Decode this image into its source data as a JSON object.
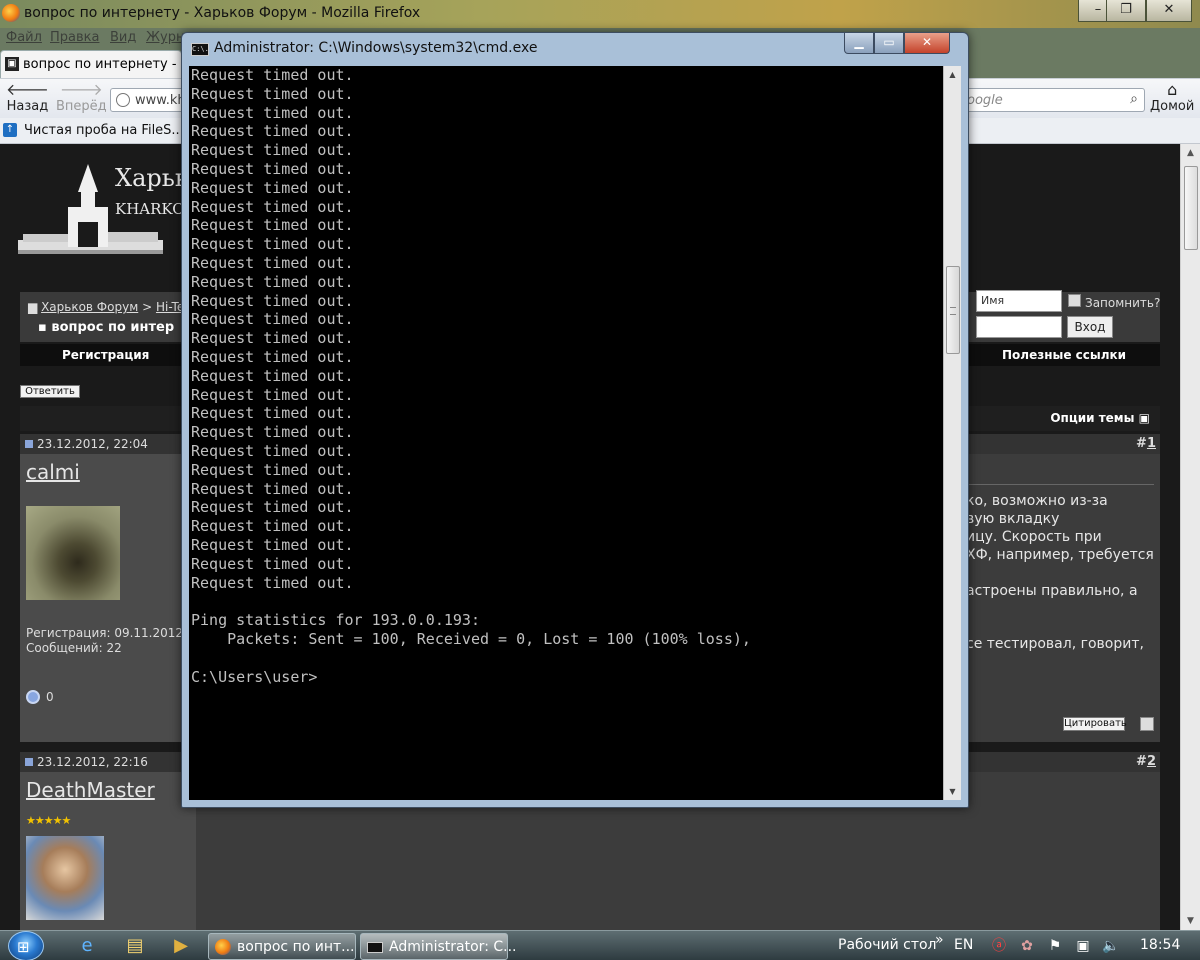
{
  "firefox": {
    "window_title": "вопрос по интернету - Харьков Форум - Mozilla Firefox",
    "menu": [
      "Файл",
      "Правка",
      "Вид",
      "Журнал"
    ],
    "tab_label": "вопрос по интернету - Х",
    "back_label": "Назад",
    "forward_label": "Вперёд",
    "url_text": "www.kh",
    "search_placeholder": "oogle",
    "home_label": "Домой",
    "bookmark_label": "Чистая проба на FileS...",
    "controls": {
      "minimize": "–",
      "maximize": "❐",
      "close": "✕"
    }
  },
  "forum": {
    "logo_title": "Харьков",
    "logo_subtitle": "KHARKOV",
    "breadcrumb_root": "Харьков Форум",
    "breadcrumb_sep": ">",
    "breadcrumb_section": "Hi-Te",
    "thread_title": "вопрос по интер",
    "login_name_placeholder": "Имя",
    "remember_label": "Запомнить?",
    "login_button": "Вход",
    "nav_register": "Регистрация",
    "nav_links": "Полезные ссылки",
    "reply_button": "Ответить",
    "thread_options": "Опции темы",
    "posts": [
      {
        "date": "23.12.2012, 22:04",
        "number_prefix": "#",
        "number": "1",
        "username": "calmi",
        "registration": "Регистрация: 09.11.2012",
        "messages": "Сообщений: 22",
        "reputation": "0",
        "text_lines": [
          "ко, возможно из-за",
          "вую вкладку",
          "ицу. Скорость при",
          "ХФ, например, требуется",
          "",
          "астроены правильно, а",
          "",
          "се тестировал, говорит,"
        ],
        "quote_button": "Цитировать"
      },
      {
        "date": "23.12.2012, 22:16",
        "number_prefix": "#",
        "number": "2",
        "username": "DeathMaster",
        "stars": "★★★★★"
      }
    ]
  },
  "cmd": {
    "title": "Administrator: C:\\Windows\\system32\\cmd.exe",
    "icon_text": "C:\\.",
    "lines": [
      "Request timed out.",
      "Request timed out.",
      "Request timed out.",
      "Request timed out.",
      "Request timed out.",
      "Request timed out.",
      "Request timed out.",
      "Request timed out.",
      "Request timed out.",
      "Request timed out.",
      "Request timed out.",
      "Request timed out.",
      "Request timed out.",
      "Request timed out.",
      "Request timed out.",
      "Request timed out.",
      "Request timed out.",
      "Request timed out.",
      "Request timed out.",
      "Request timed out.",
      "Request timed out.",
      "Request timed out.",
      "Request timed out.",
      "Request timed out.",
      "Request timed out.",
      "Request timed out.",
      "Request timed out.",
      "Request timed out.",
      "",
      "Ping statistics for 193.0.0.193:",
      "    Packets: Sent = 100, Received = 0, Lost = 100 (100% loss),",
      "",
      "C:\\Users\\user>"
    ]
  },
  "taskbar": {
    "tasks": [
      {
        "label": "вопрос по инт...",
        "icon": "firefox-icon"
      },
      {
        "label": "Administrator: C...",
        "icon": "cmd-icon"
      }
    ],
    "desktop_label": "Рабочий стол",
    "desktop_chevron": "»",
    "lang": "EN",
    "clock": "18:54"
  }
}
